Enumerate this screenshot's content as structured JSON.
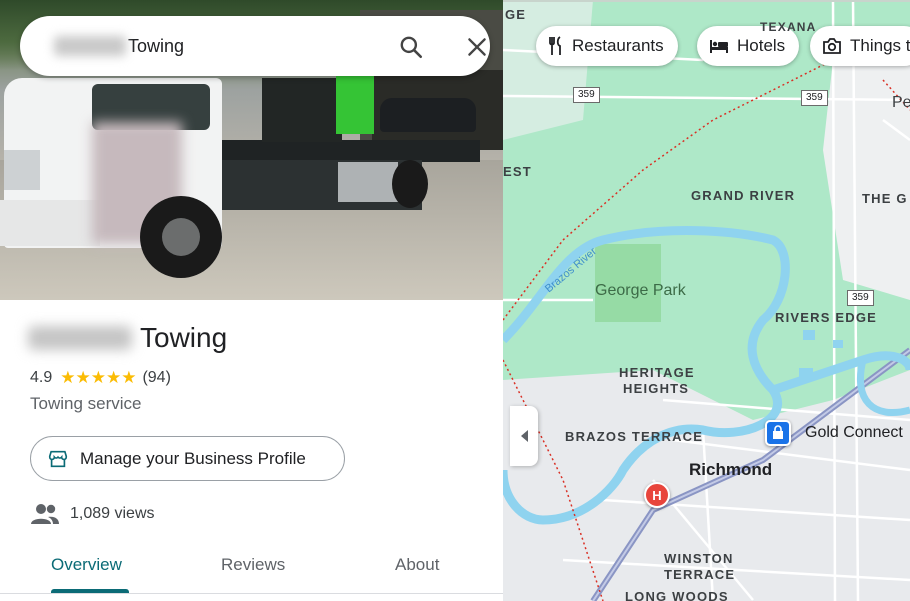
{
  "search": {
    "query": "Towing"
  },
  "business": {
    "name_suffix": "Towing",
    "rating": "4.9",
    "stars": "★★★★★",
    "review_count": "(94)",
    "category": "Towing service",
    "manage_profile_label": "Manage your Business Profile",
    "views": "1,089 views"
  },
  "tabs": [
    {
      "label": "Overview",
      "active": true
    },
    {
      "label": "Reviews",
      "active": false
    },
    {
      "label": "About",
      "active": false
    }
  ],
  "chips": [
    {
      "label": "Restaurants",
      "icon": "fork-knife-icon"
    },
    {
      "label": "Hotels",
      "icon": "bed-icon"
    },
    {
      "label": "Things t",
      "icon": "camera-icon"
    }
  ],
  "map": {
    "labels": {
      "ge": "GE",
      "texana": "TEXANA",
      "est": "EST",
      "grand_river": "GRAND RIVER",
      "the_g": "THE G",
      "rivers_edge": "RIVERS EDGE",
      "heritage_1": "HERITAGE",
      "heritage_2": "HEIGHTS",
      "brazos_terrace": "BRAZOS TERRACE",
      "winston_1": "WINSTON",
      "winston_2": "TERRACE",
      "long_woods": "LONG WOODS",
      "pe": "Pe"
    },
    "park": "George Park",
    "river": "Brazos River",
    "city": "Richmond",
    "poi": "Gold Connect",
    "hospital_letter": "H",
    "route_shields": [
      "359",
      "359",
      "359"
    ],
    "colors": {
      "land": "#aee8c8",
      "water": "#8fd3ef",
      "road": "#ffffff",
      "highway": "#8a95c4",
      "boundary": "#d93025"
    }
  },
  "accent_color": "#0b6b76"
}
